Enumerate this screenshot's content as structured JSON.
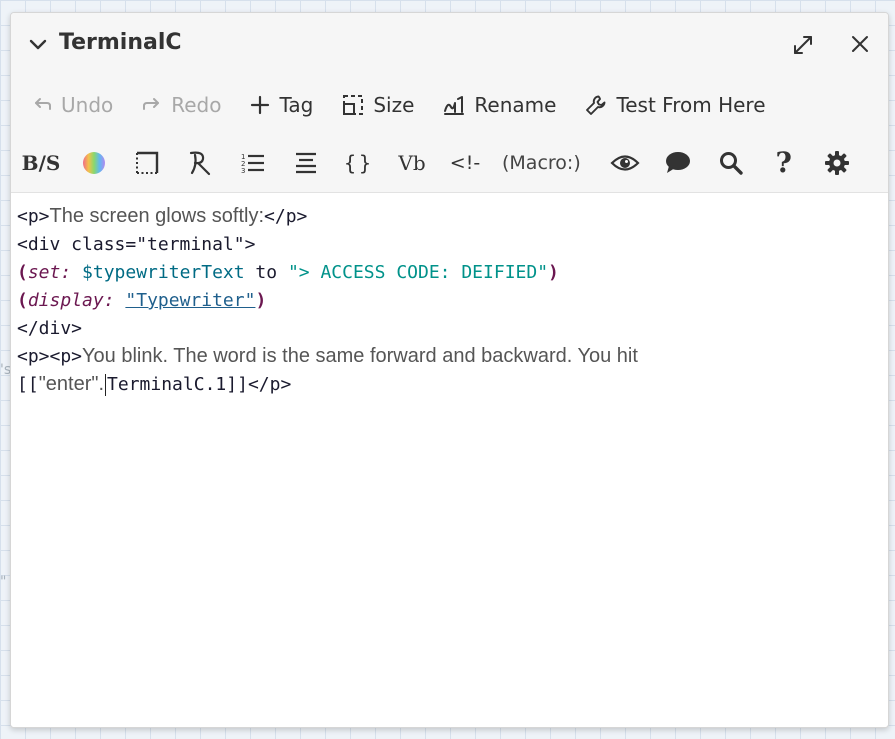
{
  "dialog": {
    "title": "TerminalC"
  },
  "toolbar": {
    "undo": "Undo",
    "redo": "Redo",
    "tag": "Tag",
    "size": "Size",
    "rename": "Rename",
    "test_from_here": "Test From Here"
  },
  "formatbar": {
    "strikethrough_label": "B/S",
    "align_label": "Vb",
    "macro_label": "(Macro:)",
    "comment_label": "<!-",
    "brackets_label": "{}",
    "help_label": "?"
  },
  "editor": {
    "line1": {
      "open": "<p>",
      "text": "The screen glows softly:",
      "close": "</p>"
    },
    "line2": {
      "text": "<div class=\"terminal\">"
    },
    "line3": {
      "open_paren": "(",
      "macro": "set:",
      "var": " $typewriterText",
      "kw": " to ",
      "str": "\"> ACCESS CODE: DEIFIED\"",
      "close_paren": ")"
    },
    "line4": {
      "open_paren": "(",
      "macro": "display:",
      "space": " ",
      "str": "\"Typewriter\"",
      "close_paren": ")"
    },
    "line5": {
      "text": "</div>"
    },
    "line6": {
      "open": "<p><p>",
      "text": "You blink. The word is the same forward and backward. You hit"
    },
    "line7": {
      "open_bracket": "[[",
      "link_text": "\"enter\".",
      "target": "TerminalC.1",
      "close_bracket": "]]",
      "close": "</p>"
    }
  },
  "colors": {
    "macro": "#6b1750",
    "variable": "#006b84",
    "string": "#00928a",
    "underlined_string": "#1f5f8c"
  }
}
